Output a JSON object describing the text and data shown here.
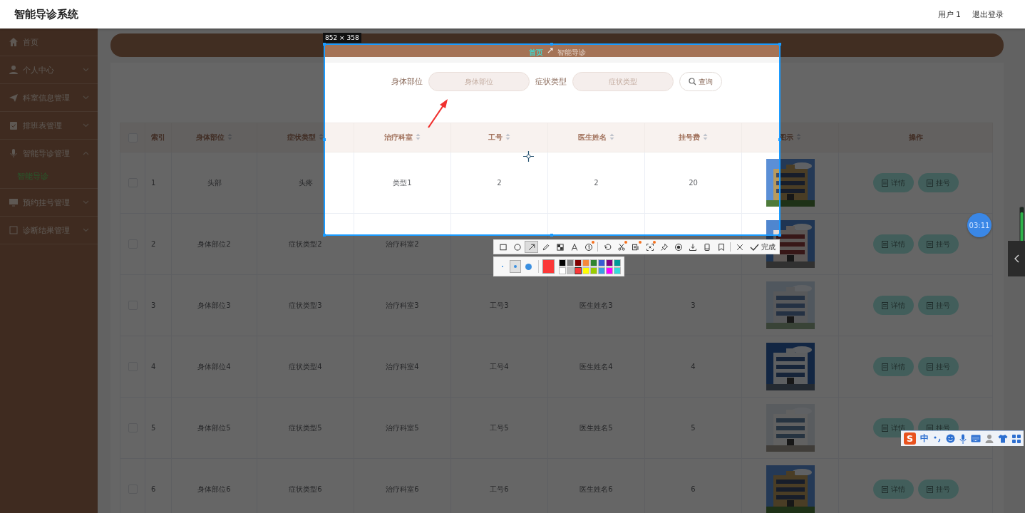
{
  "header": {
    "title": "智能导诊系统",
    "user": "用户 1",
    "logout": "退出登录"
  },
  "sidebar": {
    "items": [
      {
        "label": "首页"
      },
      {
        "label": "个人中心",
        "expanded": false
      },
      {
        "label": "科室信息管理",
        "expanded": false
      },
      {
        "label": "排班表管理",
        "expanded": false
      },
      {
        "label": "智能导诊管理",
        "expanded": true,
        "children": [
          {
            "label": "智能导诊",
            "selected": true
          }
        ]
      },
      {
        "label": "预约挂号管理",
        "expanded": false
      },
      {
        "label": "诊断结果管理",
        "expanded": false
      }
    ]
  },
  "breadcrumb": {
    "home": "首页",
    "current": "智能导诊"
  },
  "search": {
    "fields": [
      {
        "label": "身体部位",
        "placeholder": "身体部位"
      },
      {
        "label": "症状类型",
        "placeholder": "症状类型"
      }
    ],
    "button": "查询"
  },
  "table": {
    "all_checked": false,
    "columns": [
      {
        "label": "索引",
        "sortable": false
      },
      {
        "label": "身体部位",
        "sortable": true
      },
      {
        "label": "症状类型",
        "sortable": true
      },
      {
        "label": "治疗科室",
        "sortable": true
      },
      {
        "label": "工号",
        "sortable": true
      },
      {
        "label": "医生姓名",
        "sortable": true
      },
      {
        "label": "挂号费",
        "sortable": true
      },
      {
        "label": "图示",
        "sortable": true
      },
      {
        "label": "操作",
        "sortable": false
      }
    ],
    "rows": [
      {
        "checked": false,
        "cells": [
          "1",
          "头部",
          "头疼",
          "类型1",
          "2",
          "2",
          "20"
        ],
        "actions": [
          "详情",
          "挂号"
        ]
      },
      {
        "checked": false,
        "cells": [
          "2",
          "身体部位2",
          "症状类型2",
          "治疗科室2",
          null,
          null,
          null
        ],
        "actions": [
          "详情",
          "挂号"
        ]
      },
      {
        "checked": false,
        "cells": [
          "3",
          "身体部位3",
          "症状类型3",
          "治疗科室3",
          "工号3",
          "医生姓名3",
          "3"
        ],
        "actions": [
          "详情",
          "挂号"
        ]
      },
      {
        "checked": false,
        "cells": [
          "4",
          "身体部位4",
          "症状类型4",
          "治疗科室4",
          "工号4",
          "医生姓名4",
          "4"
        ],
        "actions": [
          "详情",
          "挂号"
        ]
      },
      {
        "checked": false,
        "cells": [
          "5",
          "身体部位5",
          "症状类型5",
          "治疗科室5",
          "工号5",
          "医生姓名5",
          "5"
        ],
        "actions": [
          "详情",
          "挂号"
        ]
      },
      {
        "checked": false,
        "cells": [
          "6",
          "身体部位6",
          "症状类型6",
          "治疗科室6",
          "工号6",
          "医生姓名6",
          "6"
        ],
        "actions": [
          "详情",
          "挂号"
        ]
      }
    ]
  },
  "capture": {
    "size_label": "852 × 358",
    "tool_groups": [
      [
        {
          "kind": "rectangle",
          "selected": false,
          "badge": false
        },
        {
          "kind": "ellipse",
          "selected": false,
          "badge": false
        },
        {
          "kind": "arrow",
          "selected": true,
          "badge": false
        },
        {
          "kind": "pencil",
          "selected": false,
          "badge": false
        },
        {
          "kind": "mosaic",
          "selected": false,
          "badge": false
        },
        {
          "kind": "text",
          "selected": false,
          "badge": false
        },
        {
          "kind": "number",
          "selected": false,
          "badge": true
        }
      ],
      [
        {
          "kind": "undo",
          "selected": false,
          "badge": false
        },
        {
          "kind": "cutout",
          "selected": false,
          "badge": true
        },
        {
          "kind": "ocr",
          "selected": false,
          "badge": true
        },
        {
          "kind": "scroll",
          "selected": false,
          "badge": true
        },
        {
          "kind": "pin",
          "selected": false,
          "badge": false
        },
        {
          "kind": "record",
          "selected": false,
          "badge": false
        },
        {
          "kind": "save",
          "selected": false,
          "badge": false
        },
        {
          "kind": "phone",
          "selected": false,
          "badge": false
        },
        {
          "kind": "bookmark",
          "selected": false,
          "badge": false
        }
      ],
      [
        {
          "kind": "close",
          "selected": false,
          "badge": false
        }
      ]
    ],
    "done": "完成",
    "pen_sizes": [
      {
        "selected": false
      },
      {
        "selected": true
      },
      {
        "selected": false
      }
    ],
    "swatches": [
      {
        "color": "#000000",
        "selected": false
      },
      {
        "color": "#808080",
        "selected": false
      },
      {
        "color": "#800000",
        "selected": false
      },
      {
        "color": "#f7883a",
        "selected": false
      },
      {
        "color": "#308430",
        "selected": false
      },
      {
        "color": "#385ad3",
        "selected": false
      },
      {
        "color": "#800080",
        "selected": false
      },
      {
        "color": "#009999",
        "selected": false
      },
      {
        "color": "#ffffff",
        "selected": false
      },
      {
        "color": "#c0c0c0",
        "selected": false
      },
      {
        "color": "#fb3838",
        "selected": true
      },
      {
        "color": "#ffff00",
        "selected": false
      },
      {
        "color": "#99cc00",
        "selected": false
      },
      {
        "color": "#3d9ee4",
        "selected": false
      },
      {
        "color": "#ff00ff",
        "selected": false
      },
      {
        "color": "#33dddd",
        "selected": false
      }
    ]
  },
  "timer": {
    "time": "03:11"
  },
  "ime": {
    "logo": "S",
    "mode": "中"
  }
}
